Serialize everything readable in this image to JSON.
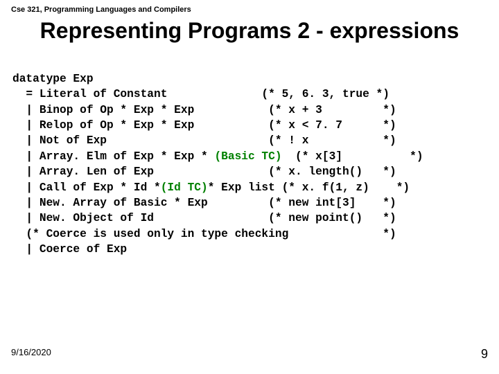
{
  "course_header": "Cse 321, Programming Languages and Compilers",
  "title": "Representing Programs 2 - expressions",
  "code": {
    "l0": "datatype Exp",
    "l1": "  = Literal of Constant              (* 5, 6. 3, true *)",
    "l2": "  | Binop of Op * Exp * Exp           (* x + 3         *)",
    "l3": "  | Relop of Op * Exp * Exp           (* x < 7. 7      *)",
    "l4": "  | Not of Exp                        (* ! x           *)",
    "l5a": "  | Array. Elm of Exp * Exp * ",
    "l5b": "(Basic TC)",
    "l5c": "  (* x[3]          *)",
    "l6": "  | Array. Len of Exp                 (* x. length()   *)",
    "l7a": "  | Call of Exp * Id *",
    "l7b": "(Id TC)",
    "l7c": "* Exp list (* x. f(1, z)    *)",
    "l8": "  | New. Array of Basic * Exp         (* new int[3]    *)",
    "l9": "  | New. Object of Id                 (* new point()   *)",
    "l10": "  (* Coerce is used only in type checking              *)",
    "l11": "  | Coerce of Exp"
  },
  "footer_date": "9/16/2020",
  "page_number": "9"
}
